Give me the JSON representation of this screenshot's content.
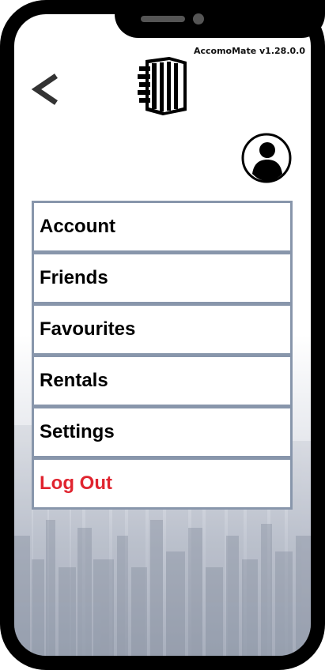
{
  "app": {
    "version_label": "AccomoMate v1.28.0.0"
  },
  "header": {
    "back_icon": "chevron-left-icon",
    "logo_icon": "building-icon",
    "avatar_icon": "user-avatar-icon"
  },
  "menu": {
    "items": [
      {
        "label": "Account"
      },
      {
        "label": "Friends"
      },
      {
        "label": "Favourites"
      },
      {
        "label": "Rentals"
      },
      {
        "label": "Settings"
      },
      {
        "label": "Log Out",
        "color": "#e0242f"
      }
    ]
  },
  "colors": {
    "menu_border": "#8896ab",
    "logout_text": "#e0242f",
    "phone_frame": "#000000"
  }
}
